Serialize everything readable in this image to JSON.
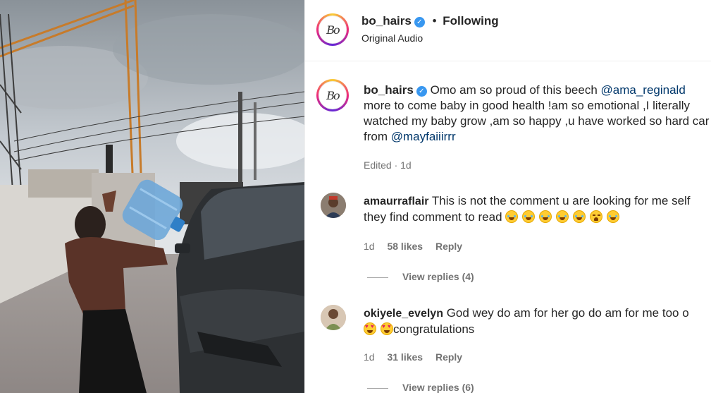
{
  "post": {
    "username": "bo_hairs",
    "avatar_initials": "Bo",
    "bullet": "•",
    "follow_status": "Following",
    "audio": "Original Audio",
    "caption": {
      "part1": "Omo am so proud of this beech ",
      "mention1": "@ama_reginald",
      "part2": " more to come baby in good health !am so emotional ,I literally watched my baby grow ,am so happy ,u have worked so hard car from ",
      "mention2": "@mayfaiiirrr"
    },
    "edited": "Edited · 1d"
  },
  "comments": [
    {
      "username": "amaurraflair",
      "text": "This is not the comment u are looking for me self they find comment to read",
      "emojis": [
        "laugh",
        "laugh",
        "laugh",
        "laugh",
        "laugh",
        "tired",
        "laugh"
      ],
      "time": "1d",
      "likes": "58 likes",
      "reply": "Reply",
      "view_replies": "View replies (4)"
    },
    {
      "username": "okiyele_evelyn",
      "text": "God wey do am for her go do am for me too o",
      "text2": "congratulations",
      "emojis": [
        "heart-eyes",
        "heart-eyes"
      ],
      "time": "1d",
      "likes": "31 likes",
      "reply": "Reply",
      "view_replies": "View replies (6)"
    }
  ],
  "colors": {
    "link": "#00376b",
    "verified": "#3897f0",
    "meta": "#737373"
  },
  "icons": [
    "verified-badge-icon"
  ]
}
